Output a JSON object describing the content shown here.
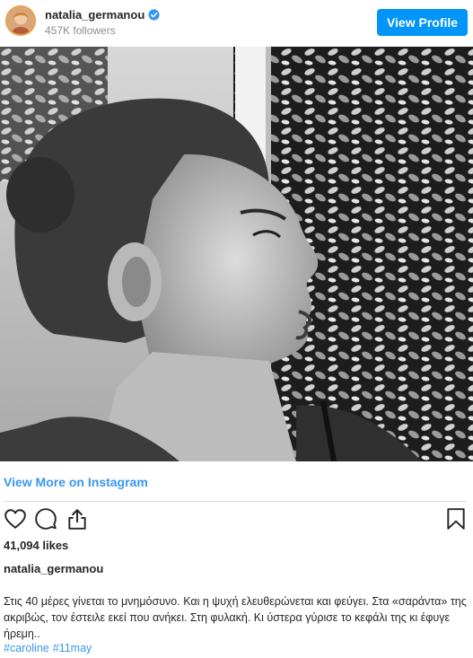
{
  "header": {
    "username": "natalia_germanou",
    "followers": "457K followers",
    "view_profile_label": "View Profile"
  },
  "post": {
    "view_more_label": "View More on Instagram",
    "likes": "41,094 likes",
    "author": "natalia_germanou",
    "caption": "Στις 40 μέρες γίνεται το μνημόσυνο. Και η ψυχή ελευθερώνεται και φεύγει. Στα «σαράντα» της ακριβώς, τον έστειλε εκεί που ανήκει. Στη φυλακή. Κι ύστερα γύρισε το κεφάλι της κι έφυγε ήρεμη..",
    "hashtags": [
      "#caroline",
      "#11may"
    ]
  },
  "icons": {
    "verified": "verified-badge-icon",
    "like": "heart-icon",
    "comment": "comment-bubble-icon",
    "share": "share-icon",
    "save": "bookmark-icon"
  },
  "colors": {
    "accent": "#0095f6",
    "link": "#3897f0",
    "text": "#262626",
    "muted": "#8e8e8e"
  }
}
